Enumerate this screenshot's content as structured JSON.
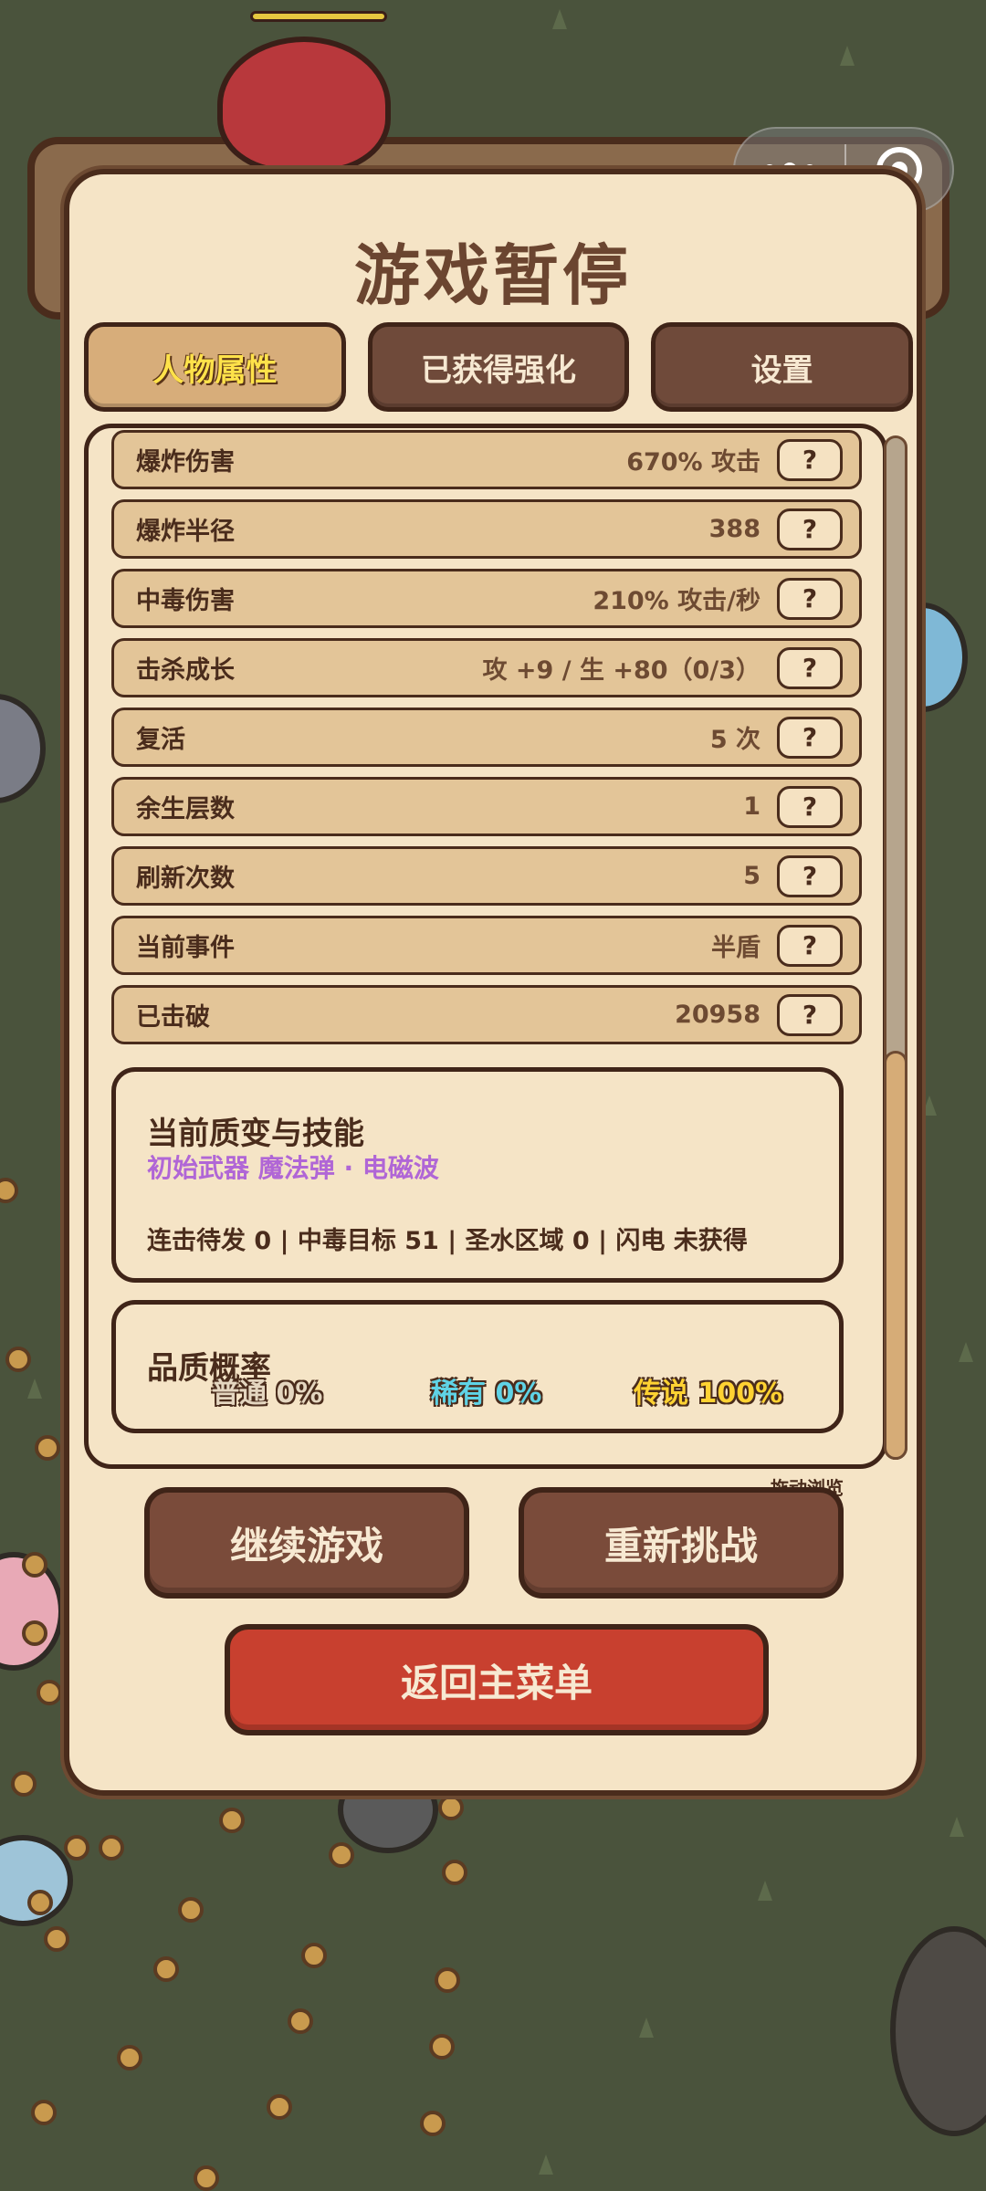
{
  "dialog": {
    "title": "游戏暂停",
    "tabs": [
      {
        "label": "人物属性",
        "active": true
      },
      {
        "label": "已获得强化",
        "active": false
      },
      {
        "label": "设置",
        "active": false
      }
    ]
  },
  "stats": [
    {
      "label": "爆炸伤害",
      "value": "670% 攻击",
      "help": "?"
    },
    {
      "label": "爆炸半径",
      "value": "388",
      "help": "?"
    },
    {
      "label": "中毒伤害",
      "value": "210% 攻击/秒",
      "help": "?"
    },
    {
      "label": "击杀成长",
      "value": "攻 +9 / 生 +80（0/3）",
      "help": "?"
    },
    {
      "label": "复活",
      "value": "5 次",
      "help": "?"
    },
    {
      "label": "余生层数",
      "value": "1",
      "help": "?"
    },
    {
      "label": "刷新次数",
      "value": "5",
      "help": "?"
    },
    {
      "label": "当前事件",
      "value": "半盾",
      "help": "?"
    },
    {
      "label": "已击破",
      "value": "20958",
      "help": "?"
    }
  ],
  "skills": {
    "title": "当前质变与技能",
    "subtitle": "初始武器 魔法弹 · 电磁波",
    "detail": "连击待发 0 | 中毒目标 51 | 圣水区域 0 | 闪电 未获得"
  },
  "quality": {
    "title": "品质概率",
    "rates": [
      {
        "text": "普通 0%",
        "color": "#e4d6c0"
      },
      {
        "text": "稀有 0%",
        "color": "#5fd3e6"
      },
      {
        "text": "传说 100%",
        "color": "#ffd232"
      }
    ]
  },
  "scroll_hint": "拖动浏览",
  "buttons": {
    "continue": "继续游戏",
    "retry": "重新挑战",
    "main_menu": "返回主菜单"
  },
  "colors": {
    "panel_bg": "#f5e4c6",
    "border": "#4a2c1c",
    "tab_active": "#d7ad7a",
    "button_brown": "#7a4b3a",
    "button_red": "#c8402f",
    "skill_accent": "#b066d6"
  },
  "icons": {
    "capsule_more": "more-dots-icon",
    "capsule_close": "close-circle-icon"
  }
}
